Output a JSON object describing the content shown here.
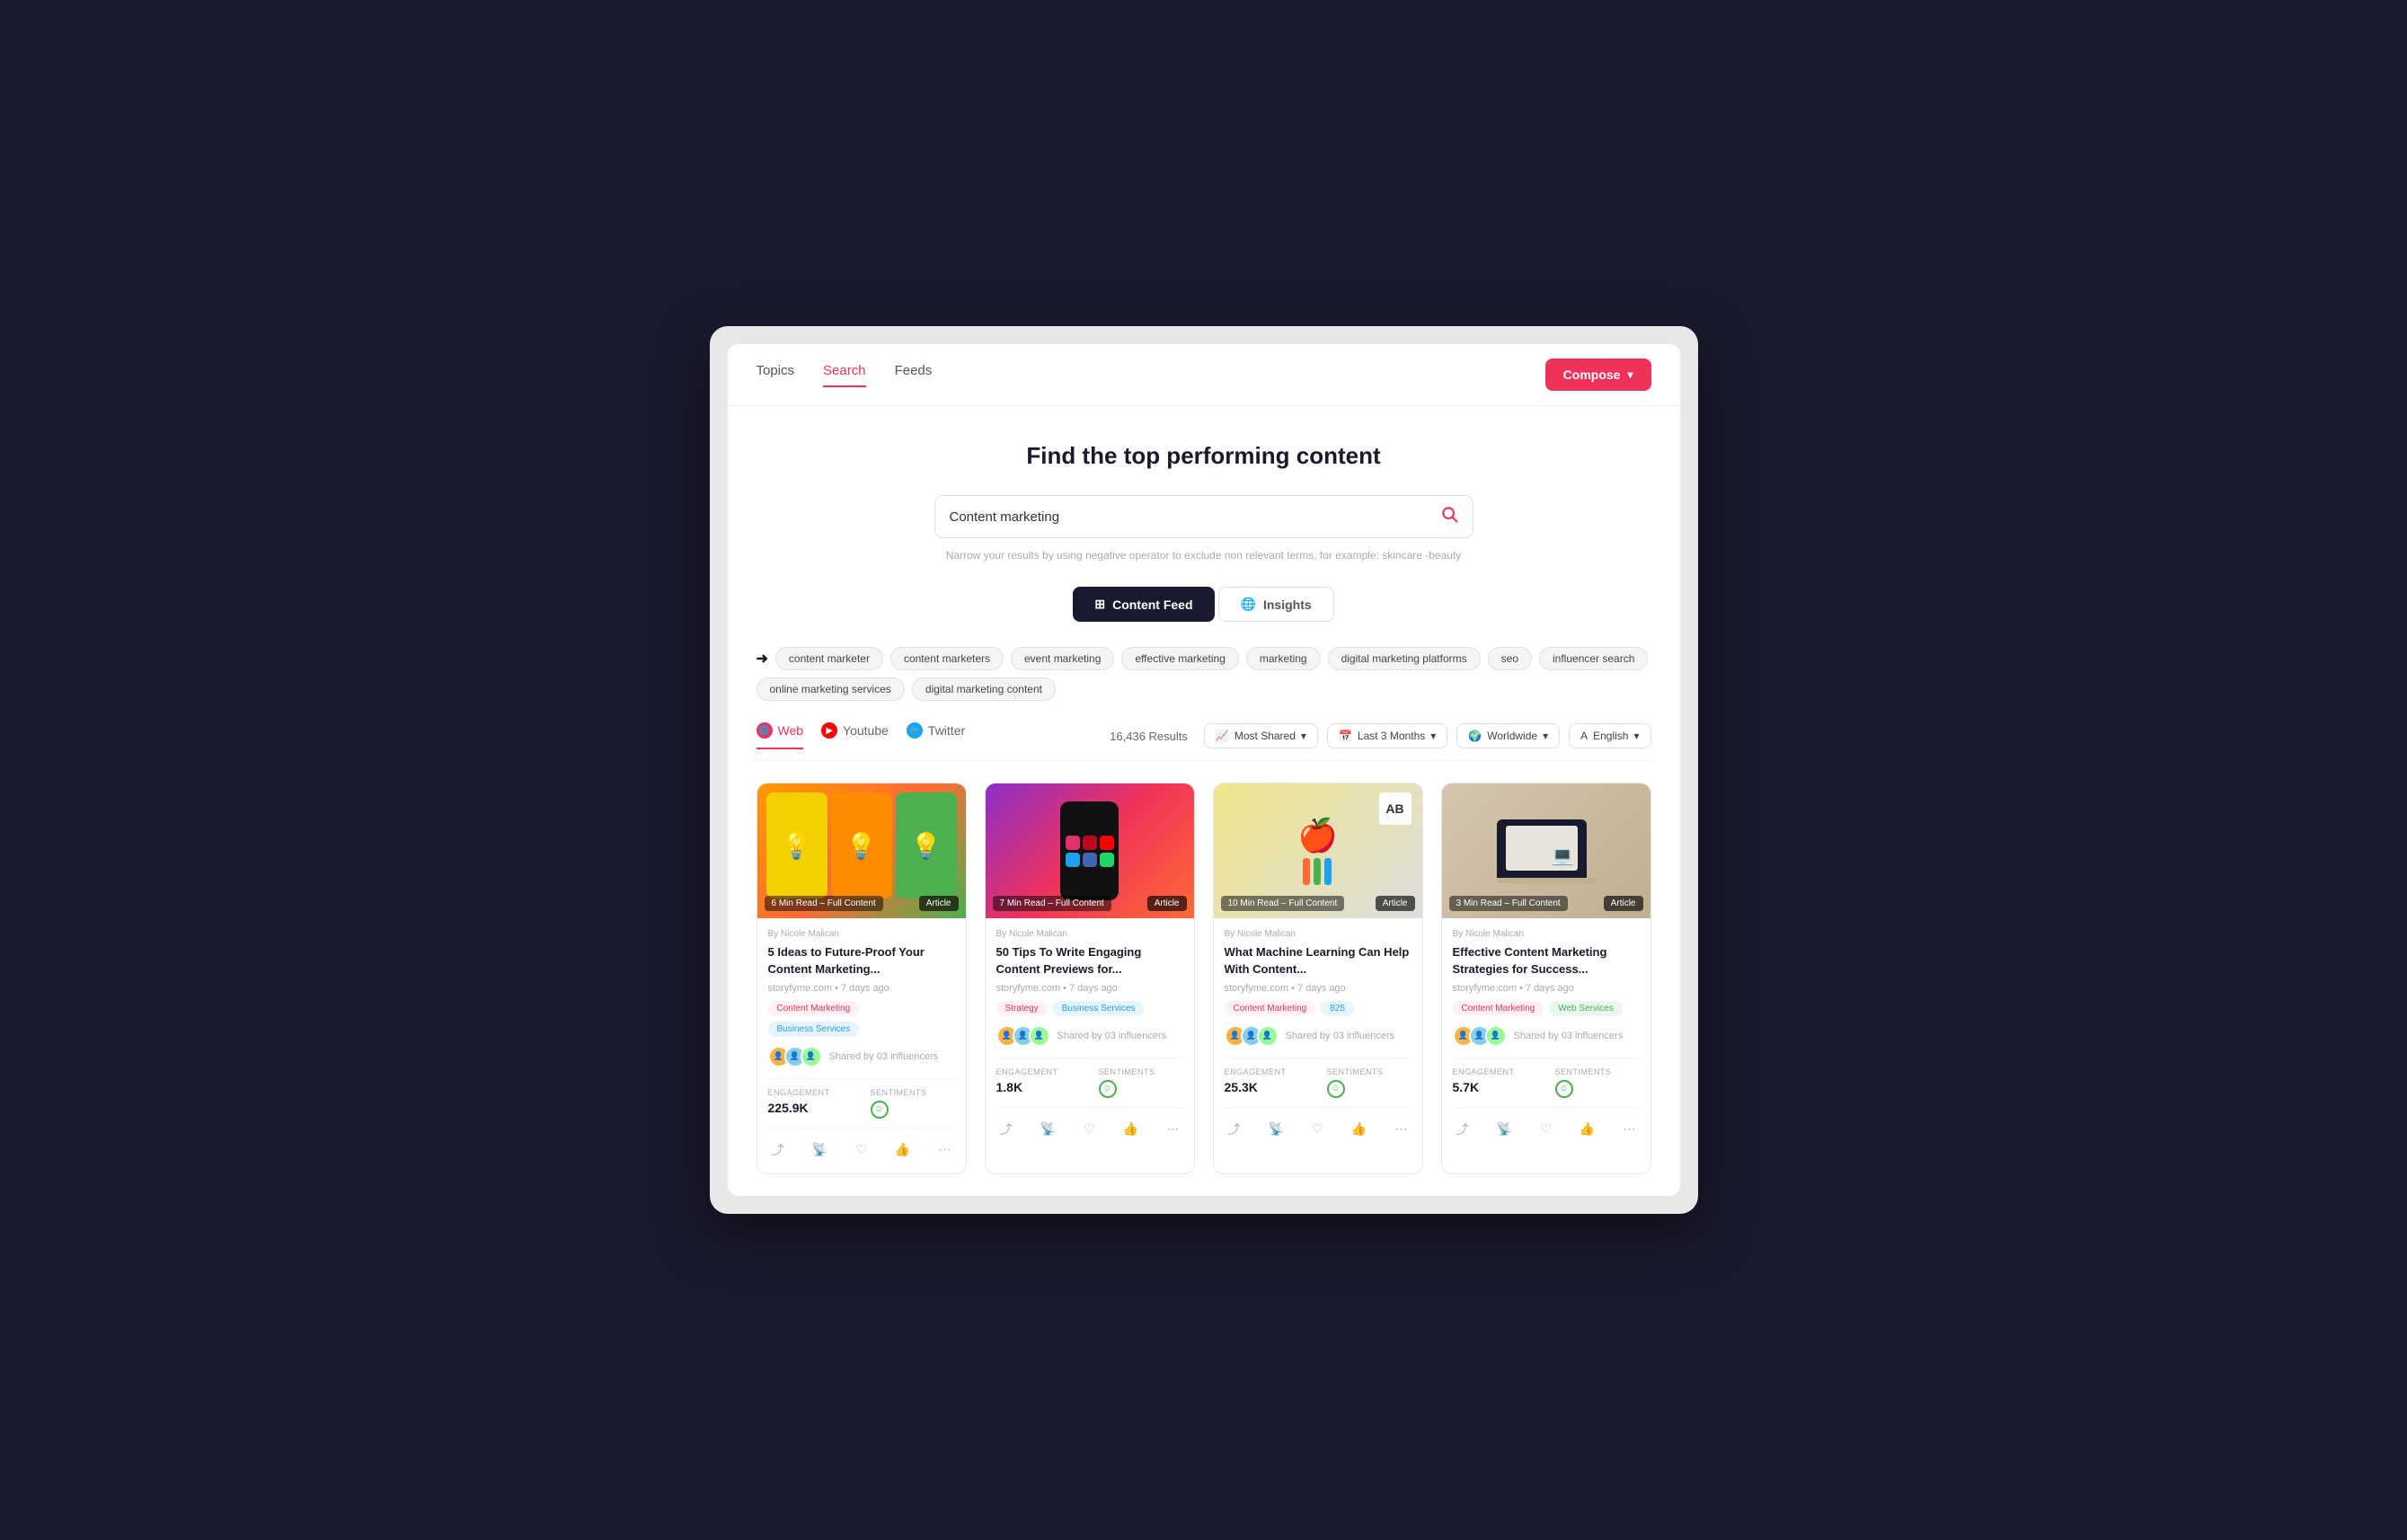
{
  "header": {
    "nav": [
      {
        "label": "Topics",
        "active": false
      },
      {
        "label": "Search",
        "active": true
      },
      {
        "label": "Feeds",
        "active": false
      }
    ],
    "compose_label": "Compose",
    "compose_chevron": "▾"
  },
  "main": {
    "title": "Find the top performing content",
    "search": {
      "value": "Content marketing",
      "placeholder": "Content marketing",
      "hint": "Narrow your results by using negative operator to exclude non relevant terms, for example: skincare -beauty"
    },
    "view_tabs": [
      {
        "label": "Content Feed",
        "icon": "⊞",
        "active": true
      },
      {
        "label": "Insights",
        "icon": "🌐",
        "active": false
      }
    ],
    "tags": [
      "content marketer",
      "content marketers",
      "event marketing",
      "effective marketing",
      "marketing",
      "digital marketing platforms",
      "seo",
      "influencer search",
      "online marketing services",
      "digital marketing content"
    ],
    "source_tabs": [
      {
        "label": "Web",
        "icon": "🌐",
        "active": true
      },
      {
        "label": "Youtube",
        "icon": "▶",
        "active": false
      },
      {
        "label": "Twitter",
        "icon": "🐦",
        "active": false
      }
    ],
    "results_count": "16,436 Results",
    "filters": [
      {
        "label": "Most Shared",
        "icon": "📈"
      },
      {
        "label": "Last 3 Months",
        "icon": "📅"
      },
      {
        "label": "Worldwide",
        "icon": "🌍"
      },
      {
        "label": "English",
        "icon": "A"
      }
    ],
    "cards": [
      {
        "id": 1,
        "author": "By Nicole Malican",
        "title": "5 Ideas to Future-Proof Your Content Marketing...",
        "source": "storyfyme.com • 7 days ago",
        "read_time": "6 Min Read – Full Content",
        "badge": "Article",
        "tags": [
          "Content Marketing",
          "Business Services"
        ],
        "influencers_text": "Shared by 03 influencers",
        "engagement": "225.9K",
        "sentiment_icon": "☺"
      },
      {
        "id": 2,
        "author": "By Nicole Malican",
        "title": "50 Tips To Write Engaging Content Previews for...",
        "source": "storyfyme.com • 7 days ago",
        "read_time": "7 Min Read – Full Content",
        "badge": "Article",
        "tags": [
          "Strategy",
          "Business Services"
        ],
        "influencers_text": "Shared by 03 influencers",
        "engagement": "1.8K",
        "sentiment_icon": "☺"
      },
      {
        "id": 3,
        "author": "By Nicole Malican",
        "title": "What Machine Learning Can Help With Content...",
        "source": "storyfyme.com • 7 days ago",
        "read_time": "10 Min Read – Full Content",
        "badge": "Article",
        "tags": [
          "Content Marketing",
          "825"
        ],
        "influencers_text": "Shared by 03 influencers",
        "engagement": "25.3K",
        "sentiment_icon": "☺"
      },
      {
        "id": 4,
        "author": "By Nicole Malican",
        "title": "Effective Content Marketing Strategies for Success...",
        "source": "storyfyme.com • 7 days ago",
        "read_time": "3 Min Read – Full Content",
        "badge": "Article",
        "tags": [
          "Content Marketing",
          "Web Services"
        ],
        "influencers_text": "Shared by 03 influencers",
        "engagement": "5.7K",
        "sentiment_icon": "☺"
      }
    ]
  }
}
